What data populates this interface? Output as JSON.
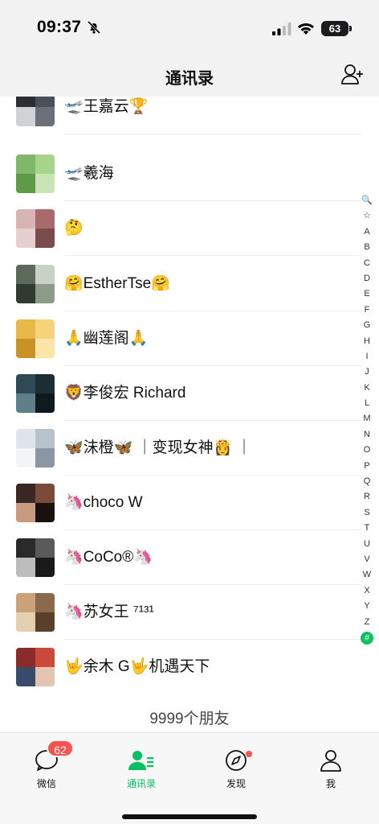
{
  "status_bar": {
    "time": "09:37",
    "battery": "63"
  },
  "nav": {
    "title": "通讯录"
  },
  "contacts": [
    {
      "name": "🛫王嘉云🏆",
      "colors": [
        "#2a2e33",
        "#4a5058",
        "#cfd2d6",
        "#6b7078"
      ]
    },
    {
      "name": "🛫羲海",
      "colors": [
        "#7fb86a",
        "#a8d38a",
        "#5e9a48",
        "#c9e4b5"
      ]
    },
    {
      "name": "🤔",
      "colors": [
        "#d9b4b4",
        "#a86a6a",
        "#e8cfcf",
        "#7a4b4b"
      ]
    },
    {
      "name": "🤗EstherTse🤗",
      "colors": [
        "#5b6a5a",
        "#c9d0c6",
        "#2f3a30",
        "#8c9a8a"
      ]
    },
    {
      "name": "🙏幽莲阁🙏",
      "colors": [
        "#e8b84a",
        "#f5d37a",
        "#c99226",
        "#fbe6a8"
      ]
    },
    {
      "name": "🦁李俊宏 Richard",
      "colors": [
        "#2d4a55",
        "#1c2e35",
        "#5f7f8a",
        "#0f1a1e"
      ]
    },
    {
      "name": "🦋沫橙🦋 ｜变现女神👸 ｜",
      "colors": [
        "#dfe4ea",
        "#b8c2cc",
        "#f2f4f7",
        "#8a96a3"
      ]
    },
    {
      "name": "🦄choco W",
      "colors": [
        "#3a2622",
        "#7a4a3a",
        "#c89a80",
        "#1a100e"
      ]
    },
    {
      "name": "🦄CoCo®🦄",
      "colors": [
        "#2a2a2a",
        "#5a5a5a",
        "#bdbdbd",
        "#1a1a1a"
      ]
    },
    {
      "name": "🦄苏女王 ⁷¹³¹",
      "colors": [
        "#c9a27a",
        "#8a6a4a",
        "#e6cfae",
        "#5a3f2a"
      ]
    },
    {
      "name": "🤟余木 G🤟机遇天下",
      "colors": [
        "#8a2b2b",
        "#c94a3a",
        "#3a4a6a",
        "#e2c4b0"
      ]
    }
  ],
  "footer": {
    "count_text": "9999个朋友"
  },
  "index_bar": [
    "🔍",
    "☆",
    "A",
    "B",
    "C",
    "D",
    "E",
    "F",
    "G",
    "H",
    "I",
    "J",
    "K",
    "L",
    "M",
    "N",
    "O",
    "P",
    "Q",
    "R",
    "S",
    "T",
    "U",
    "V",
    "W",
    "X",
    "Y",
    "Z",
    "#"
  ],
  "tabs": [
    {
      "label": "微信",
      "icon": "chat-bubble-icon",
      "badge": "62",
      "active": false
    },
    {
      "label": "通讯录",
      "icon": "contacts-icon",
      "active": true
    },
    {
      "label": "发现",
      "icon": "compass-icon",
      "dot": true,
      "active": false
    },
    {
      "label": "我",
      "icon": "person-icon",
      "active": false
    }
  ],
  "colors": {
    "accent": "#07c160",
    "badge": "#fa5151"
  }
}
